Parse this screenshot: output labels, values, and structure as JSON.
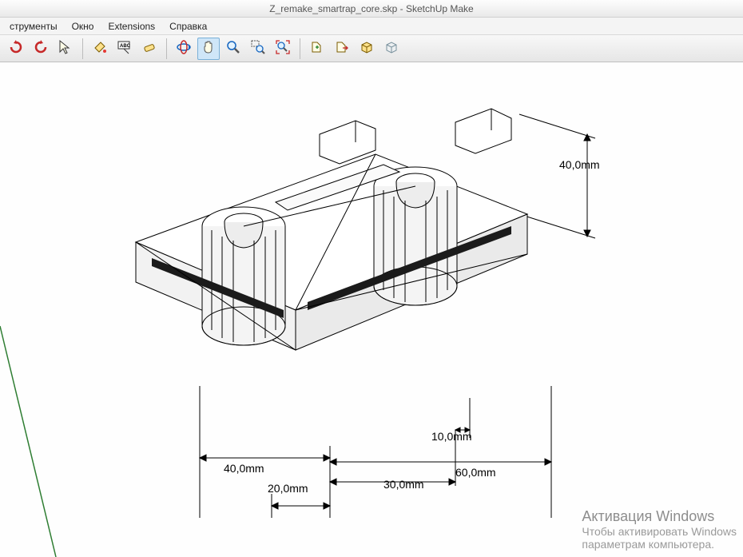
{
  "window": {
    "title": "Z_remake_smartrap_core.skp - SketchUp Make"
  },
  "menu": {
    "items": [
      "струменты",
      "Окно",
      "Extensions",
      "Справка"
    ]
  },
  "toolbar": {
    "groups": [
      [
        "undo-icon",
        "redo-icon",
        "select-icon"
      ],
      [
        "paint-bucket-icon",
        "text-label-icon",
        "eraser-icon"
      ],
      [
        "orbit-icon",
        "pan-icon",
        "zoom-icon",
        "zoom-window-icon",
        "zoom-extents-icon"
      ],
      [
        "import-icon",
        "export-icon",
        "layers-icon",
        "section-icon"
      ]
    ],
    "active_tool": "pan-icon"
  },
  "dimensions": {
    "d1": "40,0mm",
    "d2": "40,0mm",
    "d3": "20,0mm",
    "d4": "30,0mm",
    "d5": "60,0mm",
    "d6": "10,0mm"
  },
  "watermark": {
    "title": "Активация Windows",
    "line1": "Чтобы активировать Windows",
    "line2": "параметрам компьютера."
  }
}
